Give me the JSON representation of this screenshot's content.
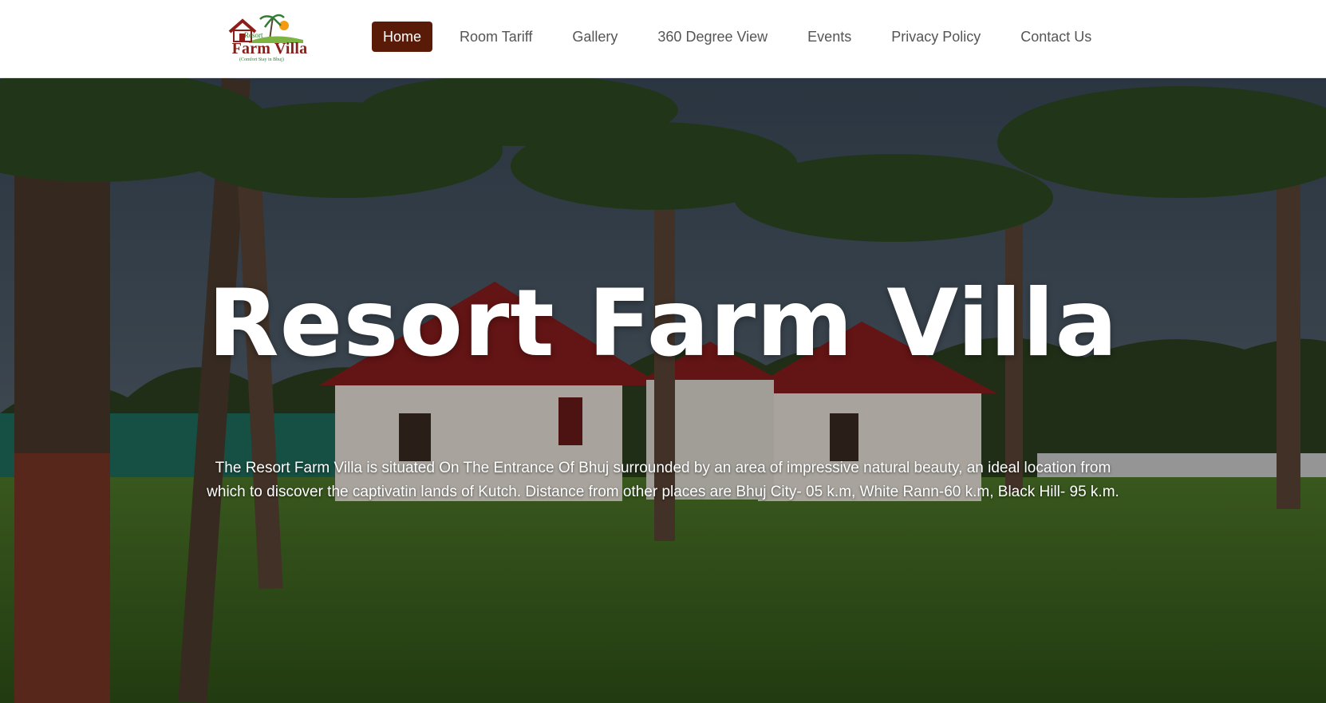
{
  "header": {
    "logo": {
      "small_text": "Resort",
      "brand_text": "Farm Villa",
      "tagline": "(Comfort Stay in Bhuj)"
    },
    "nav": [
      {
        "label": "Home",
        "active": true
      },
      {
        "label": "Room Tariff",
        "active": false
      },
      {
        "label": "Gallery",
        "active": false
      },
      {
        "label": "360 Degree View",
        "active": false
      },
      {
        "label": "Events",
        "active": false
      },
      {
        "label": "Privacy Policy",
        "active": false
      },
      {
        "label": "Contact Us",
        "active": false
      }
    ]
  },
  "hero": {
    "title": "Resort Farm Villa",
    "description": "The Resort Farm Villa is situated On The Entrance Of Bhuj surrounded by an area of impressive natural beauty, an ideal location from which to discover the captivatin lands of Kutch. Distance from other places are Bhuj City- 05 k.m, White Rann-60 k.m, Black Hill- 95 k.m."
  },
  "colors": {
    "nav_active_bg": "#5a1a08",
    "nav_text": "#555555",
    "logo_red": "#8c1d18",
    "logo_green": "#2e7d32"
  }
}
